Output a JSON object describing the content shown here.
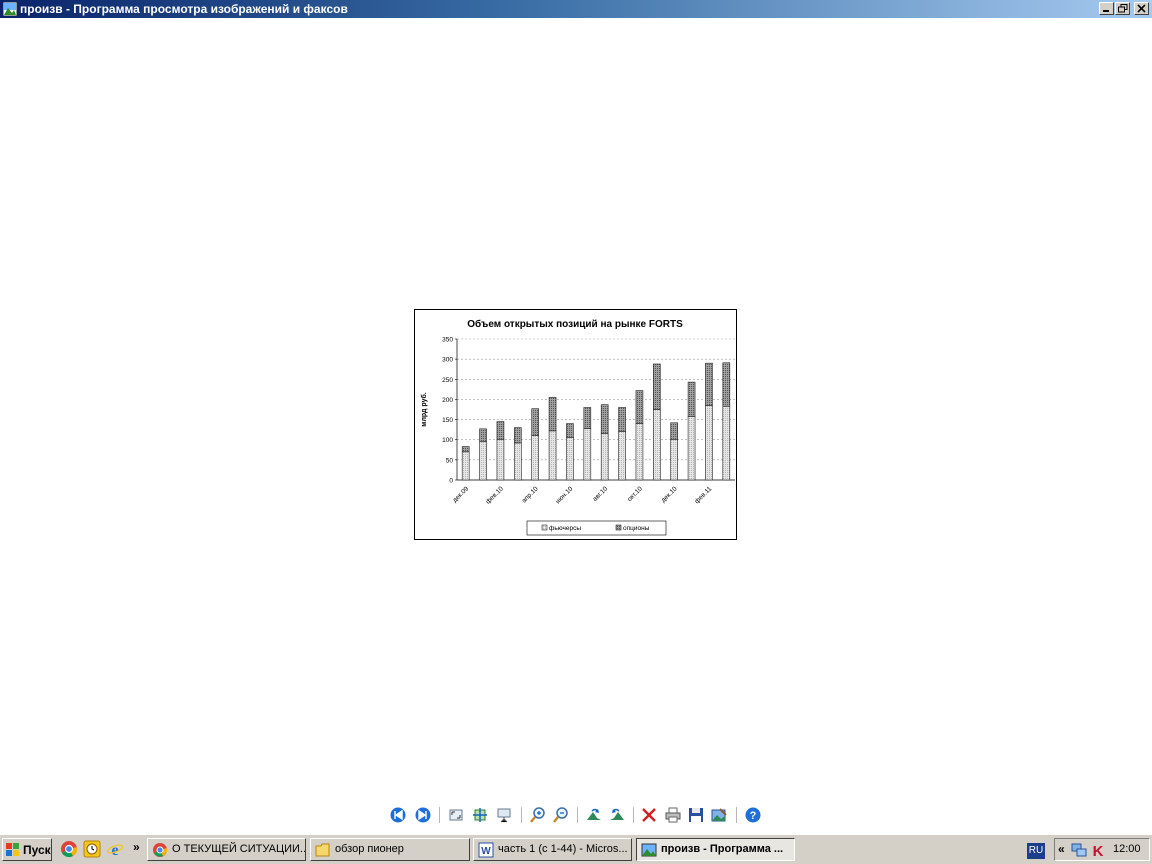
{
  "window": {
    "title": "произв - Программа просмотра изображений и факсов"
  },
  "chart_data": {
    "type": "bar",
    "stacked": true,
    "title": "Объем открытых позиций на рынке FORTS",
    "ylabel": "млрд руб.",
    "xlabel": "",
    "ylim": [
      0,
      350
    ],
    "yticks": [
      0,
      50,
      100,
      150,
      200,
      250,
      300,
      350
    ],
    "grid": true,
    "legend_position": "bottom",
    "tick_labels": [
      "дек.09",
      "фев.10",
      "апр.10",
      "июн.10",
      "авг.10",
      "окт.10",
      "дек.10",
      "фев.11"
    ],
    "series": [
      {
        "name": "фьючерсы",
        "color": "#d8d8d8",
        "values": [
          70,
          95,
          100,
          92,
          110,
          122,
          105,
          128,
          115,
          120,
          140,
          175,
          100,
          158,
          185,
          183
        ]
      },
      {
        "name": "опционы",
        "color": "#8c8c8c",
        "values": [
          13,
          32,
          45,
          38,
          67,
          83,
          35,
          52,
          72,
          60,
          82,
          113,
          42,
          85,
          105,
          108
        ]
      }
    ]
  },
  "toolbar": {
    "items": [
      {
        "name": "previous-image-button",
        "icon": "prev-icon"
      },
      {
        "name": "next-image-button",
        "icon": "next-icon"
      },
      {
        "name": "best-fit-button",
        "icon": "best-fit-icon"
      },
      {
        "name": "actual-size-button",
        "icon": "actual-size-icon"
      },
      {
        "name": "slideshow-button",
        "icon": "slideshow-icon"
      },
      {
        "name": "zoom-in-button",
        "icon": "zoom-in-icon"
      },
      {
        "name": "zoom-out-button",
        "icon": "zoom-out-icon"
      },
      {
        "name": "rotate-clockwise-button",
        "icon": "rotate-cw-icon"
      },
      {
        "name": "rotate-counterclockwise-button",
        "icon": "rotate-ccw-icon"
      },
      {
        "name": "delete-button",
        "icon": "delete-icon"
      },
      {
        "name": "print-button",
        "icon": "print-icon"
      },
      {
        "name": "save-button",
        "icon": "save-icon"
      },
      {
        "name": "edit-button",
        "icon": "edit-icon"
      },
      {
        "name": "help-button",
        "icon": "help-icon"
      }
    ]
  },
  "taskbar": {
    "start_label": "Пуск",
    "tasks": [
      {
        "label": "О ТЕКУЩЕЙ СИТУАЦИИ...",
        "icon": "chrome-icon",
        "active": false
      },
      {
        "label": "обзор пионер",
        "icon": "folder-icon",
        "active": false
      },
      {
        "label": "часть 1 (с 1-44) - Micros...",
        "icon": "word-icon",
        "active": false
      },
      {
        "label": "произв - Программа ...",
        "icon": "image-viewer-icon",
        "active": true
      }
    ],
    "language": "RU",
    "clock": "12:00"
  }
}
